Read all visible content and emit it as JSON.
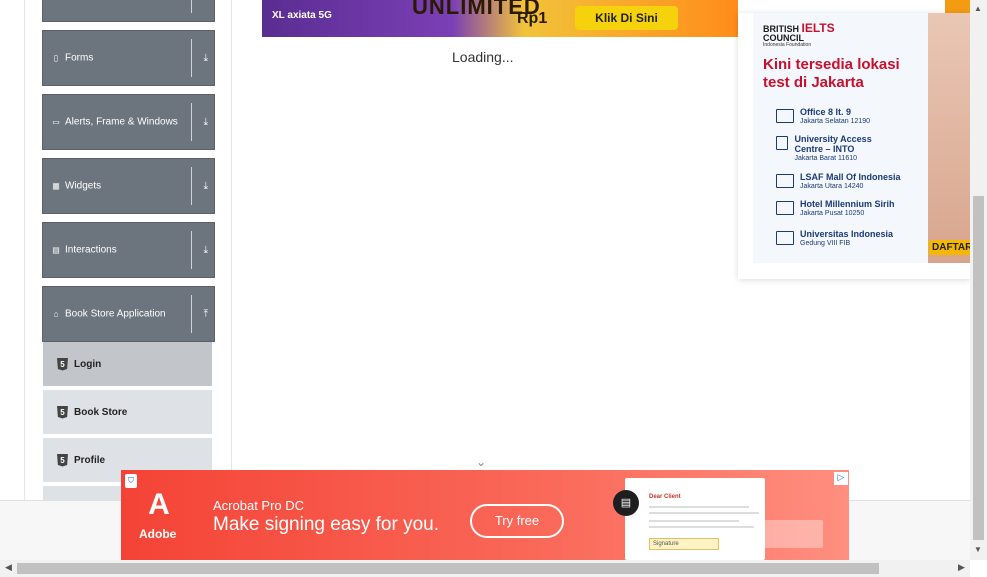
{
  "sidebar": {
    "groups": [
      {
        "label": "Forms",
        "icon": "file-icon",
        "arrow": "⤓"
      },
      {
        "label": "Alerts, Frame & Windows",
        "icon": "window-icon",
        "arrow": "⤓"
      },
      {
        "label": "Widgets",
        "icon": "grid-icon",
        "arrow": "⤓"
      },
      {
        "label": "Interactions",
        "icon": "list-icon",
        "arrow": "⤓"
      },
      {
        "label": "Book Store Application",
        "icon": "book-icon",
        "arrow": "⤒"
      }
    ],
    "items": [
      {
        "label": "Login"
      },
      {
        "label": "Book Store"
      },
      {
        "label": "Profile"
      }
    ]
  },
  "main": {
    "loading_text": "Loading..."
  },
  "top_ad": {
    "brand": "XL axiata 5G",
    "headline": "UNLIMITED",
    "price": "Rp1",
    "cta": "Klik Di Sini"
  },
  "ielts_ad": {
    "org_line1": "BRITISH",
    "org_line2": "COUNCIL",
    "brand": "IELTS",
    "foundation": "Indonesia Foundation",
    "headline_1": "Kini tersedia lokasi",
    "headline_2": "test di Jakarta",
    "locations": [
      {
        "name": "Office 8 lt. 9",
        "address": "Jakarta Selatan 12190"
      },
      {
        "name": "University Access Centre – INTO",
        "address": "Jakarta Barat 11610"
      },
      {
        "name": "LSAF Mall Of Indonesia",
        "address": "Jakarta Utara 14240"
      },
      {
        "name": "Hotel Millennium Sirih",
        "address": "Jakarta Pusat 10250"
      },
      {
        "name": "Universitas Indonesia",
        "address": "Gedung VIII FIB"
      }
    ],
    "cta": "DAFTAR"
  },
  "adobe_ad": {
    "brand": "Adobe",
    "product": "Acrobat Pro DC",
    "message": "Make signing easy for you.",
    "cta": "Try free",
    "doc_title": "Dear Client",
    "signature_label": "Signature",
    "accent": "#f44336"
  }
}
